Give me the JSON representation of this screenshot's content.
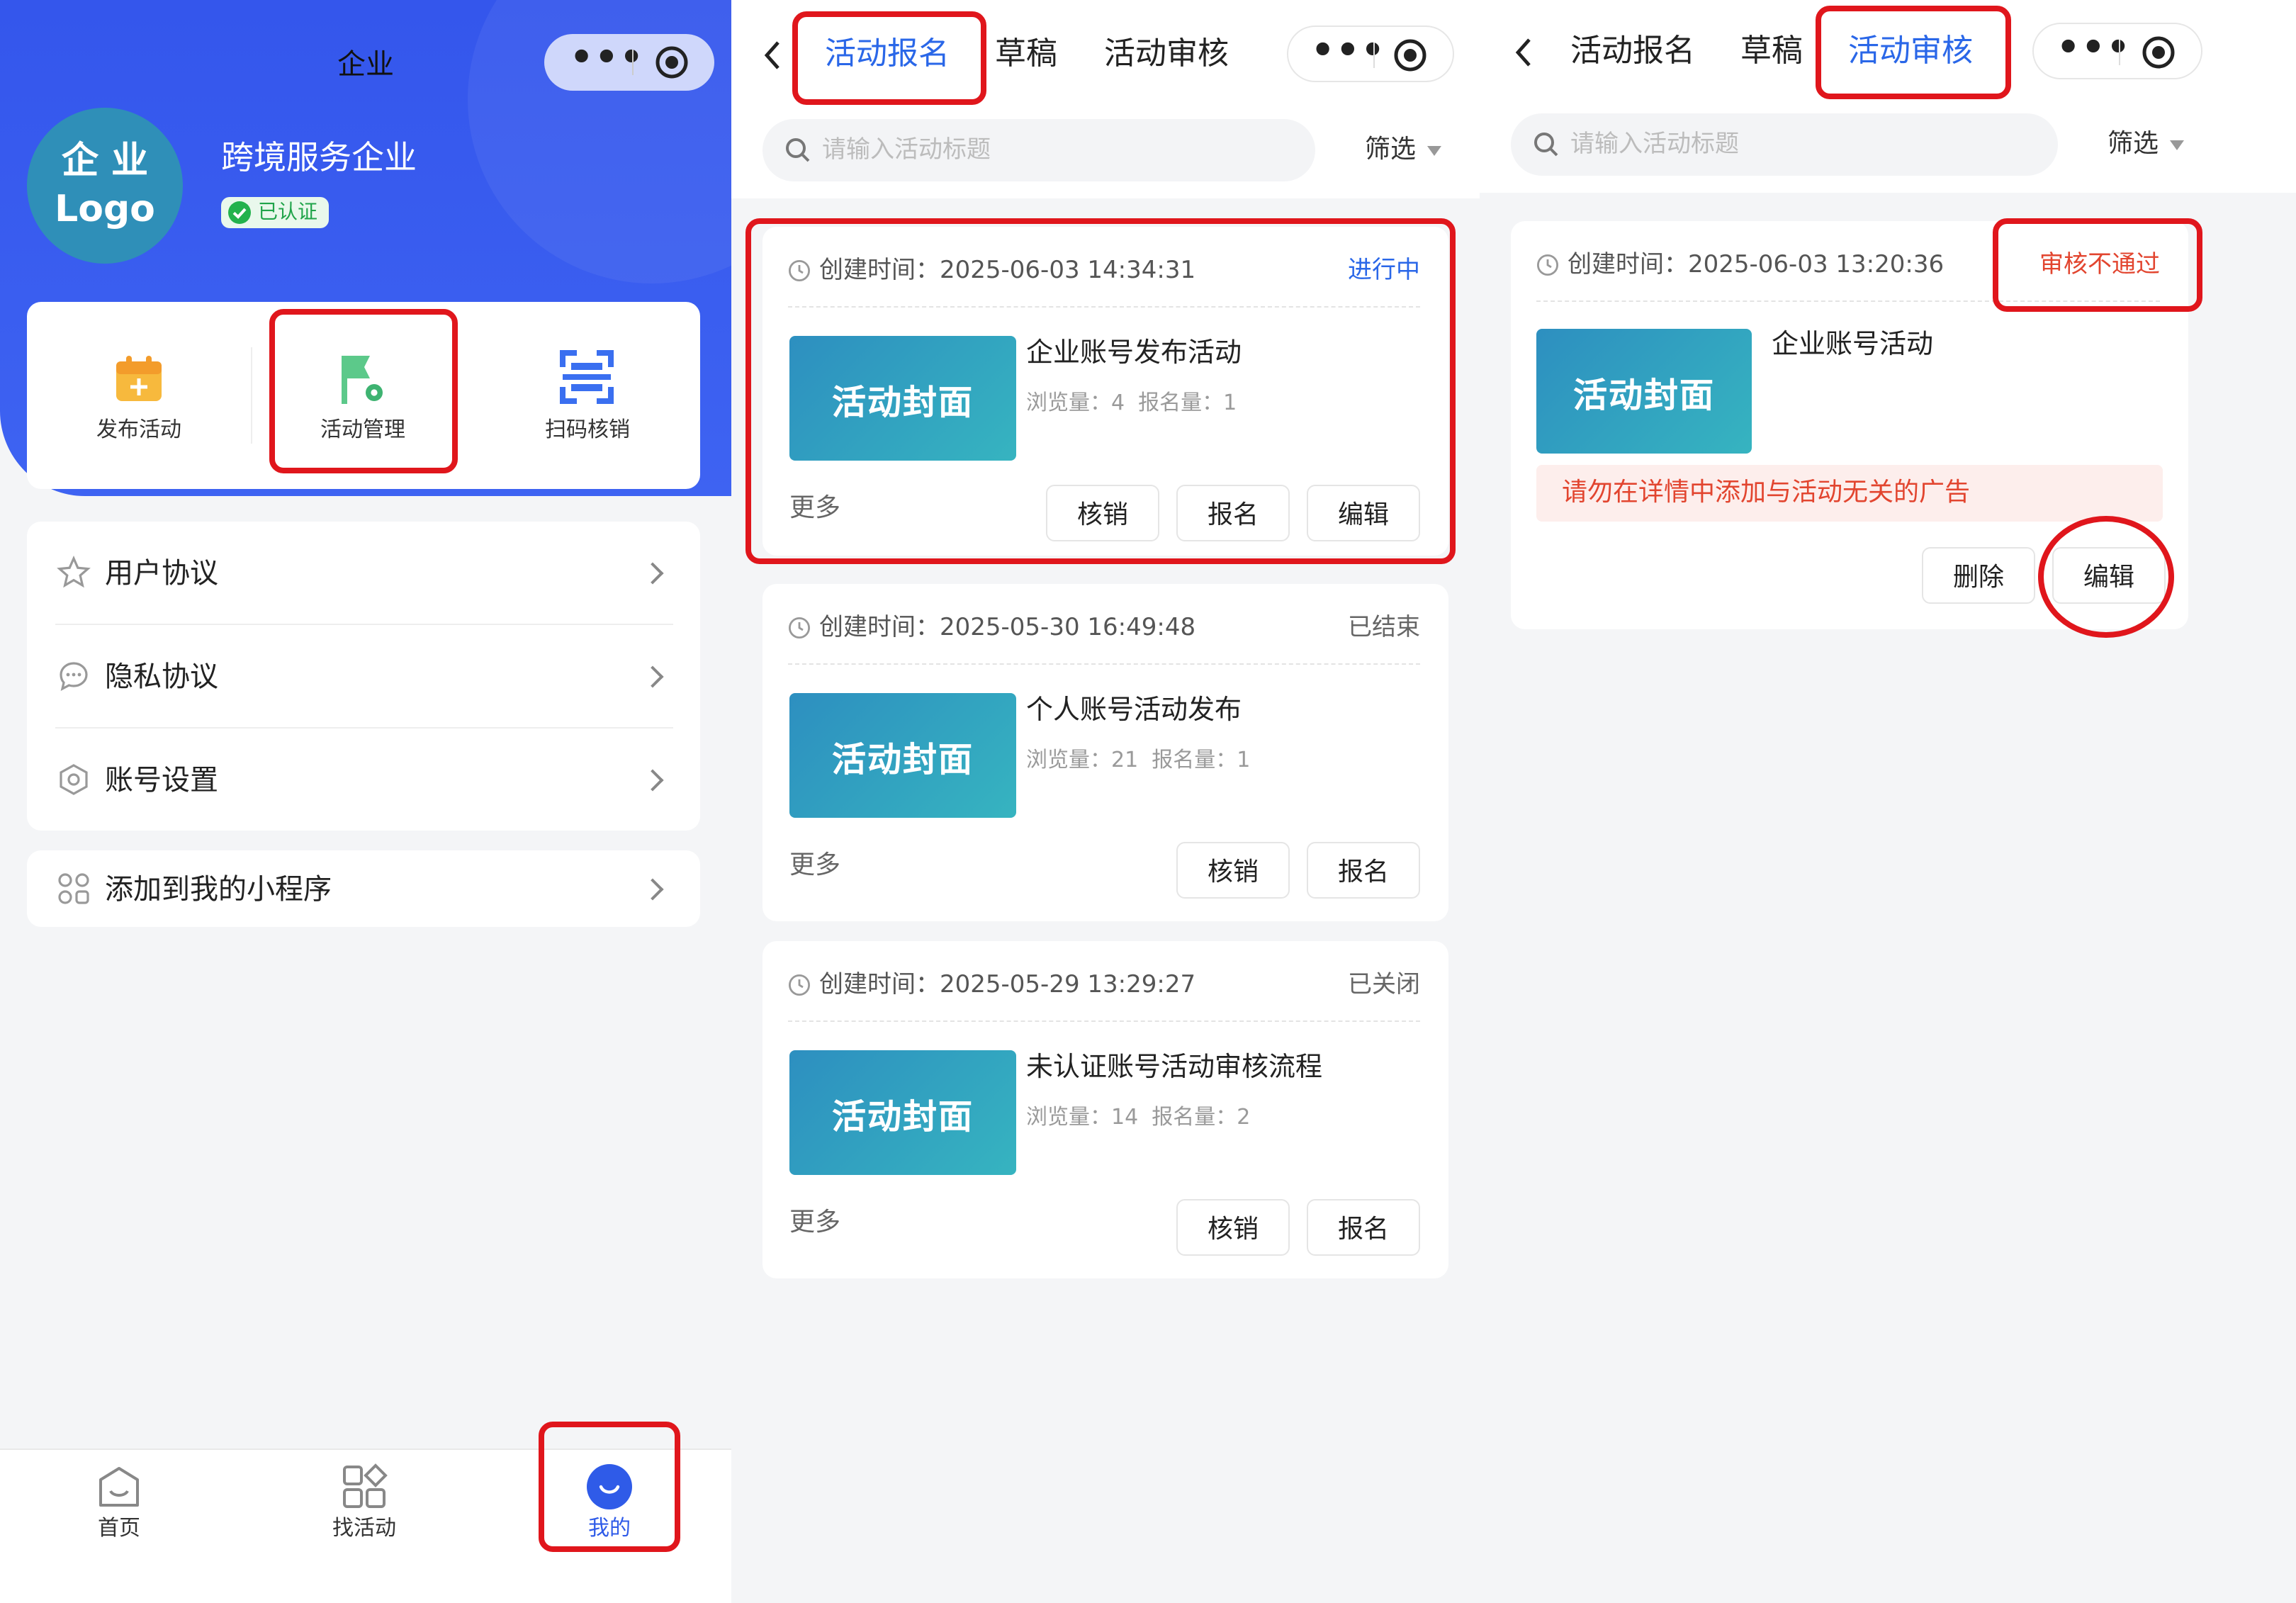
{
  "screen1": {
    "nav_title": "企业",
    "company_logo": "企 业\nLogo",
    "company_name": "跨境服务企业",
    "verified_badge": "已认证",
    "quick_actions": [
      {
        "label": "发布活动",
        "icon": "calendar-add-icon"
      },
      {
        "label": "活动管理",
        "icon": "flag-gear-icon"
      },
      {
        "label": "扫码核销",
        "icon": "scan-code-icon"
      }
    ],
    "menu": [
      {
        "label": "用户协议",
        "icon": "star-icon"
      },
      {
        "label": "隐私协议",
        "icon": "chat-bubble-icon"
      },
      {
        "label": "账号设置",
        "icon": "hexagon-settings-icon"
      }
    ],
    "add_to_mine": {
      "label": "添加到我的小程序",
      "icon": "apps-icon"
    },
    "tabbar": [
      {
        "label": "首页",
        "icon": "home-icon",
        "active": false
      },
      {
        "label": "找活动",
        "icon": "grid-icon",
        "active": false
      },
      {
        "label": "我的",
        "icon": "smile-icon",
        "active": true
      }
    ]
  },
  "screen2": {
    "tabs": [
      "活动报名",
      "草稿",
      "活动审核"
    ],
    "active_tab": "活动报名",
    "search_placeholder": "请输入活动标题",
    "filter_label": "筛选",
    "activities": [
      {
        "created": "创建时间：2025-06-03 14:34:31",
        "status": "进行中",
        "status_color": "#2a67e8",
        "cover": "活动封面",
        "title": "企业账号发布活动",
        "stats": "浏览量：4  报名量：1",
        "more": "更多",
        "buttons": [
          "核销",
          "报名",
          "编辑"
        ]
      },
      {
        "created": "创建时间：2025-05-30 16:49:48",
        "status": "已结束",
        "status_color": "#666666",
        "cover": "活动封面",
        "title": "个人账号活动发布",
        "stats": "浏览量：21  报名量：1",
        "more": "更多",
        "buttons": [
          "核销",
          "报名"
        ]
      },
      {
        "created": "创建时间：2025-05-29 13:29:27",
        "status": "已关闭",
        "status_color": "#666666",
        "cover": "活动封面",
        "title": "未认证账号活动审核流程",
        "stats": "浏览量：14  报名量：2",
        "more": "更多",
        "buttons": [
          "核销",
          "报名"
        ]
      }
    ]
  },
  "screen3": {
    "tabs": [
      "活动报名",
      "草稿",
      "活动审核"
    ],
    "active_tab": "活动审核",
    "search_placeholder": "请输入活动标题",
    "filter_label": "筛选",
    "item": {
      "created": "创建时间：2025-06-03 13:20:36",
      "status": "审核不通过",
      "status_color": "#e2452f",
      "cover": "活动封面",
      "title": "企业账号活动",
      "reject_reason": "请勿在详情中添加与活动无关的广告",
      "buttons": [
        "删除",
        "编辑"
      ]
    }
  },
  "colors": {
    "brand_blue": "#3a5df0",
    "accent_red": "#e0161c",
    "active_tab": "#2a67e8"
  }
}
